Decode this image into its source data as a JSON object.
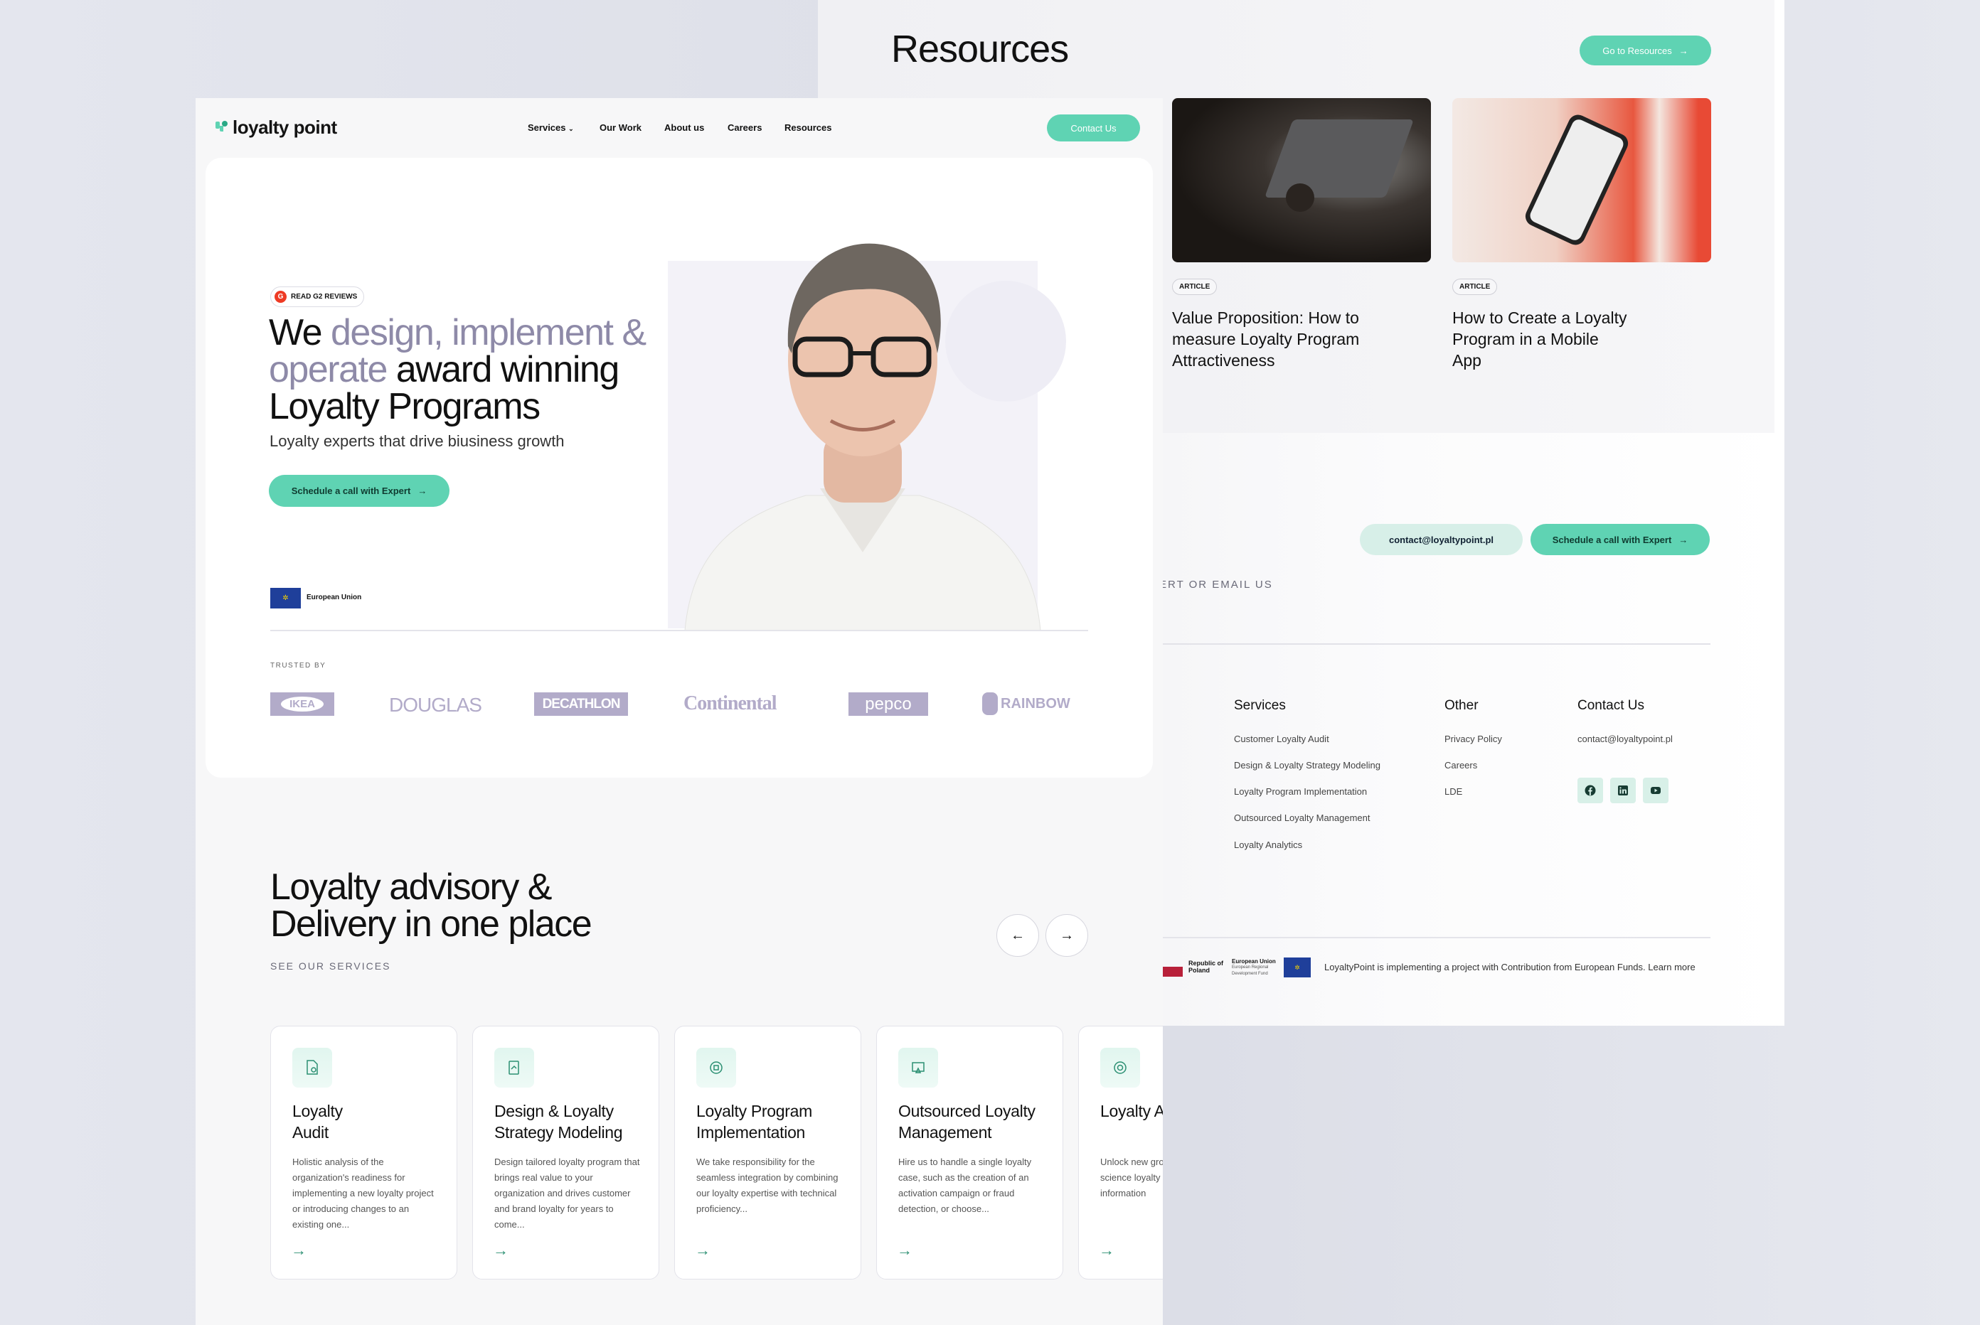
{
  "resources": {
    "title": "Resources",
    "go_button": "Go to Resources",
    "articles": [
      {
        "badge": "ARTICLE",
        "title": "Value Proposition: How to measure Loyalty Program Attractiveness"
      },
      {
        "badge": "ARTICLE",
        "title": "How to Create a Loyalty Program in a Mobile App"
      }
    ]
  },
  "contact_cta": {
    "email_button": "contact@loyaltypoint.pl",
    "schedule_button": "Schedule a call with Expert",
    "caption": "ERT OR EMAIL US"
  },
  "footer": {
    "services": {
      "heading": "Services",
      "items": [
        "Customer Loyalty Audit",
        "Design &  Loyalty Strategy Modeling",
        "Loyalty Program Implementation",
        "Outsourced Loyalty Management",
        "Loyalty Analytics"
      ]
    },
    "other": {
      "heading": "Other",
      "items": [
        "Privacy Policy",
        "Careers",
        "LDE"
      ]
    },
    "contact": {
      "heading": "Contact Us",
      "email": "contact@loyaltypoint.pl",
      "socials": [
        "facebook-icon",
        "linkedin-icon",
        "youtube-icon"
      ]
    },
    "eu_bar": {
      "poland": "Republic of Poland",
      "eu": "European Union",
      "eu_sub": "European Regional Development Fund",
      "text": "LoyaltyPoint is implementing a project with Contribution from European Funds. Learn more"
    }
  },
  "nav": {
    "logo": "loyalty point",
    "items": [
      "Services",
      "Our Work",
      "About us",
      "Careers",
      "Resources"
    ],
    "contact_button": "Contact Us"
  },
  "hero": {
    "g2_badge": "READ G2 REVIEWS",
    "headline": {
      "l1a": "We ",
      "l1b": "design, implement &",
      "l2a": "operate",
      "l2b": " award winning",
      "l3": "Loyalty Programs"
    },
    "subtitle": "Loyalty experts that drive biusiness growth",
    "cta": "Schedule a call with Expert",
    "eu_label": "European Union",
    "trusted_by": "TRUSTED BY",
    "logos": [
      "IKEA",
      "DOUGLAS",
      "DECATHLON",
      "Continental",
      "pepco",
      "RAINBOW"
    ]
  },
  "services": {
    "title_l1": "Loyalty advisory &",
    "title_l2": "Delivery in one place",
    "caption": "SEE OUR SERVICES",
    "cards": [
      {
        "title": "Loyalty\nAudit",
        "desc": "Holistic analysis of the organization's readiness for implementing a new loyalty project or introducing changes to an existing one..."
      },
      {
        "title": "Design & Loyalty Strategy Modeling",
        "desc": "Design tailored loyalty program that brings real value to your organization and drives customer and brand loyalty for years to come..."
      },
      {
        "title": "Loyalty Program Implementation",
        "desc": "We take responsibility for the seamless integration by combining our loyalty expertise with technical proficiency..."
      },
      {
        "title": "Outsourced Loyalty Management",
        "desc": "Hire us to handle a single loyalty case, such as the creation of an activation campaign or fraud detection, or choose..."
      },
      {
        "title": "Loyalty Analytics",
        "desc": "Unlock new growth using data science loyalty analytics world information"
      }
    ]
  },
  "colors": {
    "accent": "#5fd3b3",
    "muted_headline": "#8e8aa8",
    "logo_gray": "#b2abc9"
  }
}
